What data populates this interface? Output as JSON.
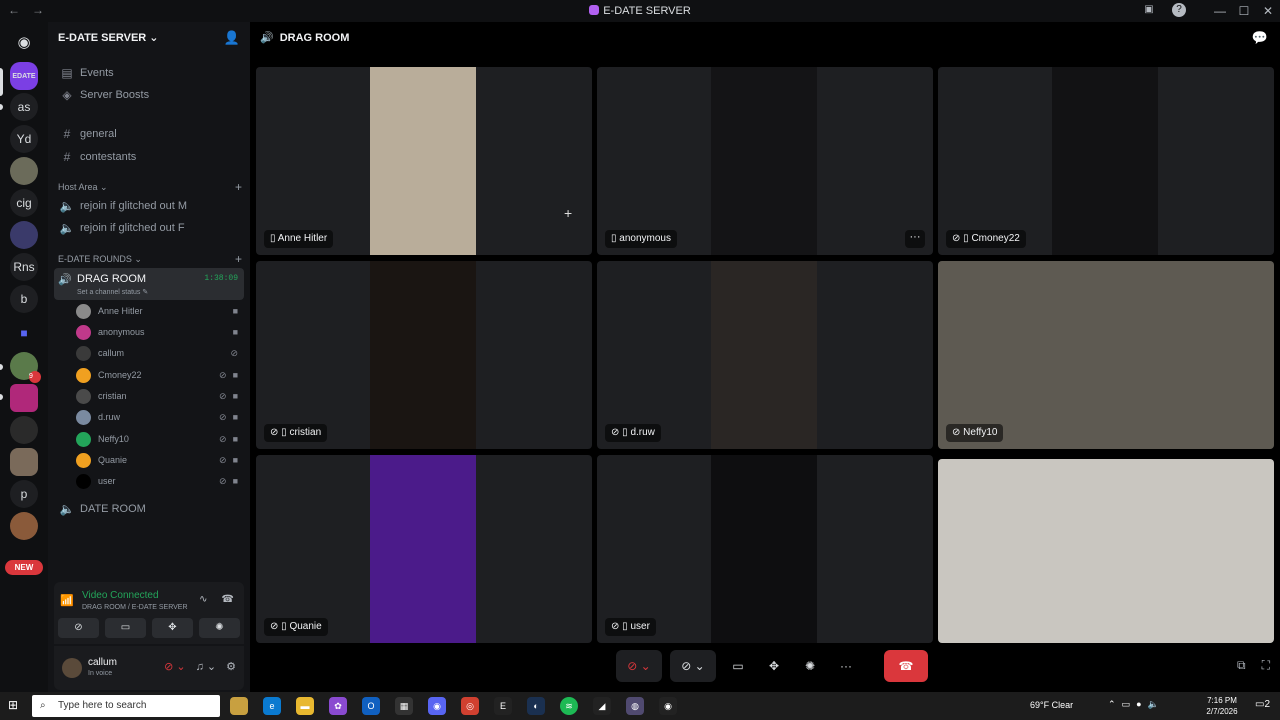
{
  "window": {
    "title": "E-DATE SERVER",
    "controls": [
      "—",
      "☐",
      "✕"
    ]
  },
  "rail": {
    "servers": [
      "as",
      "Yd",
      "cig",
      "Rns",
      "b",
      "p"
    ],
    "new_badge": "NEW",
    "notif_count": "9",
    "edate_label": "EDATE"
  },
  "sidebar": {
    "server_name": "E-DATE SERVER",
    "events": "Events",
    "boosts": "Server Boosts",
    "channels": [
      "general",
      "contestants"
    ],
    "host_area": "Host Area",
    "host_channels": [
      "rejoin if glitched out M",
      "rejoin if glitched out F"
    ],
    "rounds": "E-DATE ROUNDS",
    "drag_room": "DRAG ROOM",
    "drag_time": "1:38:09",
    "drag_status": "Set a channel status",
    "voice_users": [
      "Anne Hitler",
      "anonymous",
      "callum",
      "Cmoney22",
      "cristian",
      "d.ruw",
      "Neffy10",
      "Quanie",
      "user"
    ],
    "date_room": "DATE ROOM"
  },
  "panel": {
    "status": "Video Connected",
    "location": "DRAG ROOM / E-DATE SERVER"
  },
  "user": {
    "name": "callum",
    "status": "In voice"
  },
  "stage": {
    "title": "DRAG ROOM",
    "tiles": [
      "Anne Hitler",
      "anonymous",
      "Cmoney22",
      "cristian",
      "d.ruw",
      "Neffy10",
      "Quanie",
      "user",
      ""
    ]
  },
  "taskbar": {
    "search_placeholder": "Type here to search",
    "weather": "69°F  Clear",
    "time": "7:16 PM",
    "date": "2/7/2026",
    "notif": "2"
  },
  "colors": {
    "accent_green": "#23a55a",
    "danger_red": "#da373c",
    "tile_bg": "#1e1f22"
  }
}
